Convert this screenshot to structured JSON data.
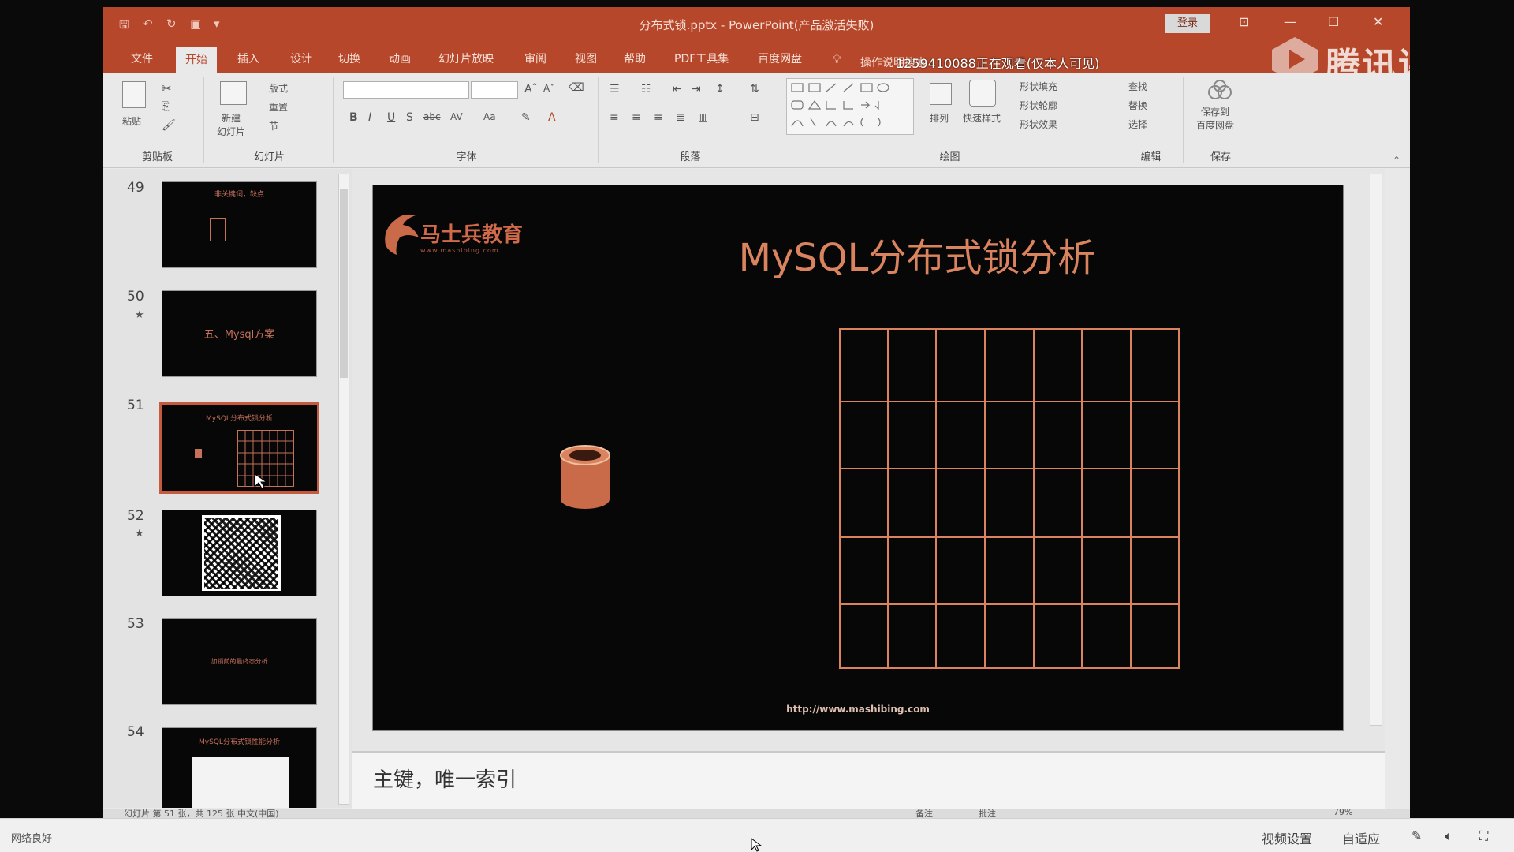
{
  "window": {
    "title": "分布式锁.pptx  -  PowerPoint(产品激活失败)",
    "login_label": "登录",
    "minimize": "—",
    "maximize": "☐",
    "close": "✕"
  },
  "tabs": [
    "文件",
    "开始",
    "插入",
    "设计",
    "切换",
    "动画",
    "幻灯片放映",
    "审阅",
    "视图",
    "帮助",
    "PDF工具集",
    "百度网盘"
  ],
  "active_tab": "开始",
  "tell_me": "操作说明搜索",
  "watching_overlay": "1259410088正在观看(仅本人可见)",
  "watermark": "腾讯课堂",
  "ribbon": {
    "clipboard": {
      "paste": "粘贴",
      "label": "剪贴板"
    },
    "slides": {
      "new_slide": "新建\n幻灯片",
      "layout": "版式",
      "reset": "重置",
      "section": "节",
      "label": "幻灯片"
    },
    "font": {
      "bold": "B",
      "italic": "I",
      "underline": "U",
      "strike": "S",
      "abc": "abc",
      "av": "AV",
      "aa": "Aa",
      "a_color": "A",
      "grow": "Aˆ",
      "shrink": "Aˇ",
      "label": "字体"
    },
    "paragraph": {
      "label": "段落"
    },
    "drawing": {
      "arrange": "排列",
      "quick_styles": "快速样式",
      "fill": "形状填充",
      "outline": "形状轮廓",
      "effects": "形状效果",
      "label": "绘图"
    },
    "editing": {
      "find": "查找",
      "replace": "替换",
      "select": "选择",
      "label": "编辑"
    },
    "save": {
      "save_to_baidu": "保存到\n百度网盘",
      "label": "保存"
    }
  },
  "thumbnails": [
    {
      "num": "49",
      "star": false,
      "text": "非关键词，缺点"
    },
    {
      "num": "50",
      "star": true,
      "text": "五、Mysql方案"
    },
    {
      "num": "51",
      "star": false,
      "text": "MySQL分布式锁分析"
    },
    {
      "num": "52",
      "star": true,
      "text": ""
    },
    {
      "num": "53",
      "star": false,
      "text": "加锁前的最终态分析"
    },
    {
      "num": "54",
      "star": false,
      "text": "MySQL分布式锁性能分析"
    }
  ],
  "selected_slide": "51",
  "slide": {
    "logo_text": "马士兵教育",
    "logo_url": "www.mashibing.com",
    "title": "MySQL分布式锁分析",
    "url": "http://www.mashibing.com",
    "grid_rows": 5,
    "grid_cols": 7,
    "accent": "#d9845f"
  },
  "notes": "主键，唯一索引",
  "status": {
    "left": "幻灯片 第 51 张，共 125 张    中文(中国)",
    "notes_btn": "备注",
    "comments_btn": "批注",
    "zoom": "79%"
  },
  "host_bar": {
    "net_status": "网络良好",
    "video_settings": "视频设置",
    "fit": "自适应"
  },
  "colors": {
    "ppt_red": "#b7472a",
    "slide_bg": "#070707",
    "orange": "#d9845f"
  }
}
